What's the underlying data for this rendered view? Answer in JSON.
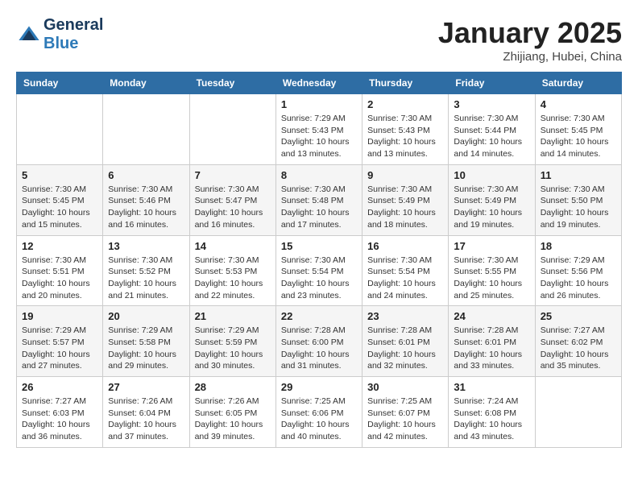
{
  "logo": {
    "line1": "General",
    "line2": "Blue"
  },
  "header": {
    "title": "January 2025",
    "subtitle": "Zhijiang, Hubei, China"
  },
  "weekdays": [
    "Sunday",
    "Monday",
    "Tuesday",
    "Wednesday",
    "Thursday",
    "Friday",
    "Saturday"
  ],
  "weeks": [
    [
      {
        "day": "",
        "info": ""
      },
      {
        "day": "",
        "info": ""
      },
      {
        "day": "",
        "info": ""
      },
      {
        "day": "1",
        "info": "Sunrise: 7:29 AM\nSunset: 5:43 PM\nDaylight: 10 hours\nand 13 minutes."
      },
      {
        "day": "2",
        "info": "Sunrise: 7:30 AM\nSunset: 5:43 PM\nDaylight: 10 hours\nand 13 minutes."
      },
      {
        "day": "3",
        "info": "Sunrise: 7:30 AM\nSunset: 5:44 PM\nDaylight: 10 hours\nand 14 minutes."
      },
      {
        "day": "4",
        "info": "Sunrise: 7:30 AM\nSunset: 5:45 PM\nDaylight: 10 hours\nand 14 minutes."
      }
    ],
    [
      {
        "day": "5",
        "info": "Sunrise: 7:30 AM\nSunset: 5:45 PM\nDaylight: 10 hours\nand 15 minutes."
      },
      {
        "day": "6",
        "info": "Sunrise: 7:30 AM\nSunset: 5:46 PM\nDaylight: 10 hours\nand 16 minutes."
      },
      {
        "day": "7",
        "info": "Sunrise: 7:30 AM\nSunset: 5:47 PM\nDaylight: 10 hours\nand 16 minutes."
      },
      {
        "day": "8",
        "info": "Sunrise: 7:30 AM\nSunset: 5:48 PM\nDaylight: 10 hours\nand 17 minutes."
      },
      {
        "day": "9",
        "info": "Sunrise: 7:30 AM\nSunset: 5:49 PM\nDaylight: 10 hours\nand 18 minutes."
      },
      {
        "day": "10",
        "info": "Sunrise: 7:30 AM\nSunset: 5:49 PM\nDaylight: 10 hours\nand 19 minutes."
      },
      {
        "day": "11",
        "info": "Sunrise: 7:30 AM\nSunset: 5:50 PM\nDaylight: 10 hours\nand 19 minutes."
      }
    ],
    [
      {
        "day": "12",
        "info": "Sunrise: 7:30 AM\nSunset: 5:51 PM\nDaylight: 10 hours\nand 20 minutes."
      },
      {
        "day": "13",
        "info": "Sunrise: 7:30 AM\nSunset: 5:52 PM\nDaylight: 10 hours\nand 21 minutes."
      },
      {
        "day": "14",
        "info": "Sunrise: 7:30 AM\nSunset: 5:53 PM\nDaylight: 10 hours\nand 22 minutes."
      },
      {
        "day": "15",
        "info": "Sunrise: 7:30 AM\nSunset: 5:54 PM\nDaylight: 10 hours\nand 23 minutes."
      },
      {
        "day": "16",
        "info": "Sunrise: 7:30 AM\nSunset: 5:54 PM\nDaylight: 10 hours\nand 24 minutes."
      },
      {
        "day": "17",
        "info": "Sunrise: 7:30 AM\nSunset: 5:55 PM\nDaylight: 10 hours\nand 25 minutes."
      },
      {
        "day": "18",
        "info": "Sunrise: 7:29 AM\nSunset: 5:56 PM\nDaylight: 10 hours\nand 26 minutes."
      }
    ],
    [
      {
        "day": "19",
        "info": "Sunrise: 7:29 AM\nSunset: 5:57 PM\nDaylight: 10 hours\nand 27 minutes."
      },
      {
        "day": "20",
        "info": "Sunrise: 7:29 AM\nSunset: 5:58 PM\nDaylight: 10 hours\nand 29 minutes."
      },
      {
        "day": "21",
        "info": "Sunrise: 7:29 AM\nSunset: 5:59 PM\nDaylight: 10 hours\nand 30 minutes."
      },
      {
        "day": "22",
        "info": "Sunrise: 7:28 AM\nSunset: 6:00 PM\nDaylight: 10 hours\nand 31 minutes."
      },
      {
        "day": "23",
        "info": "Sunrise: 7:28 AM\nSunset: 6:01 PM\nDaylight: 10 hours\nand 32 minutes."
      },
      {
        "day": "24",
        "info": "Sunrise: 7:28 AM\nSunset: 6:01 PM\nDaylight: 10 hours\nand 33 minutes."
      },
      {
        "day": "25",
        "info": "Sunrise: 7:27 AM\nSunset: 6:02 PM\nDaylight: 10 hours\nand 35 minutes."
      }
    ],
    [
      {
        "day": "26",
        "info": "Sunrise: 7:27 AM\nSunset: 6:03 PM\nDaylight: 10 hours\nand 36 minutes."
      },
      {
        "day": "27",
        "info": "Sunrise: 7:26 AM\nSunset: 6:04 PM\nDaylight: 10 hours\nand 37 minutes."
      },
      {
        "day": "28",
        "info": "Sunrise: 7:26 AM\nSunset: 6:05 PM\nDaylight: 10 hours\nand 39 minutes."
      },
      {
        "day": "29",
        "info": "Sunrise: 7:25 AM\nSunset: 6:06 PM\nDaylight: 10 hours\nand 40 minutes."
      },
      {
        "day": "30",
        "info": "Sunrise: 7:25 AM\nSunset: 6:07 PM\nDaylight: 10 hours\nand 42 minutes."
      },
      {
        "day": "31",
        "info": "Sunrise: 7:24 AM\nSunset: 6:08 PM\nDaylight: 10 hours\nand 43 minutes."
      },
      {
        "day": "",
        "info": ""
      }
    ]
  ]
}
